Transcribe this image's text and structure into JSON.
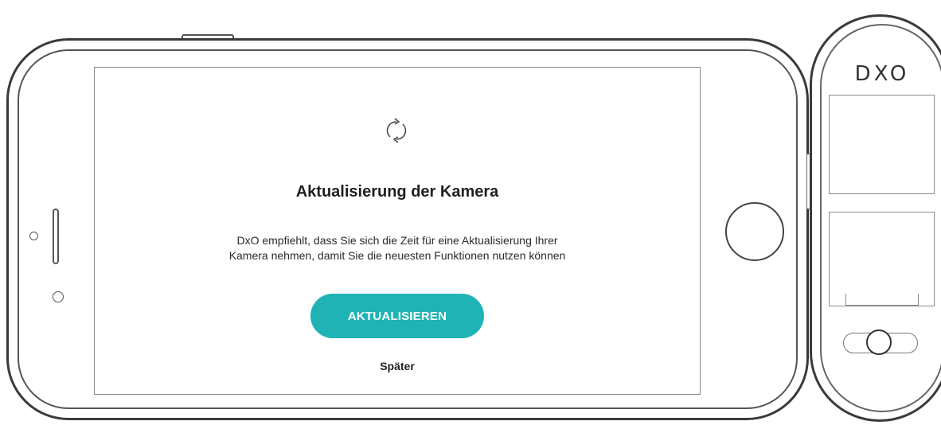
{
  "dialog": {
    "title": "Aktualisierung der Kamera",
    "description_line1": "DxO empfiehlt, dass Sie sich die Zeit für eine Aktualisierung Ihrer",
    "description_line2": "Kamera nehmen, damit Sie die neuesten Funktionen nutzen können",
    "update_button": "AKTUALISIEREN",
    "later_link": "Später",
    "icon": "sync-icon"
  },
  "camera": {
    "logo": "DXO"
  },
  "colors": {
    "accent": "#1fb3b6",
    "outline": "#3a3a3a"
  }
}
